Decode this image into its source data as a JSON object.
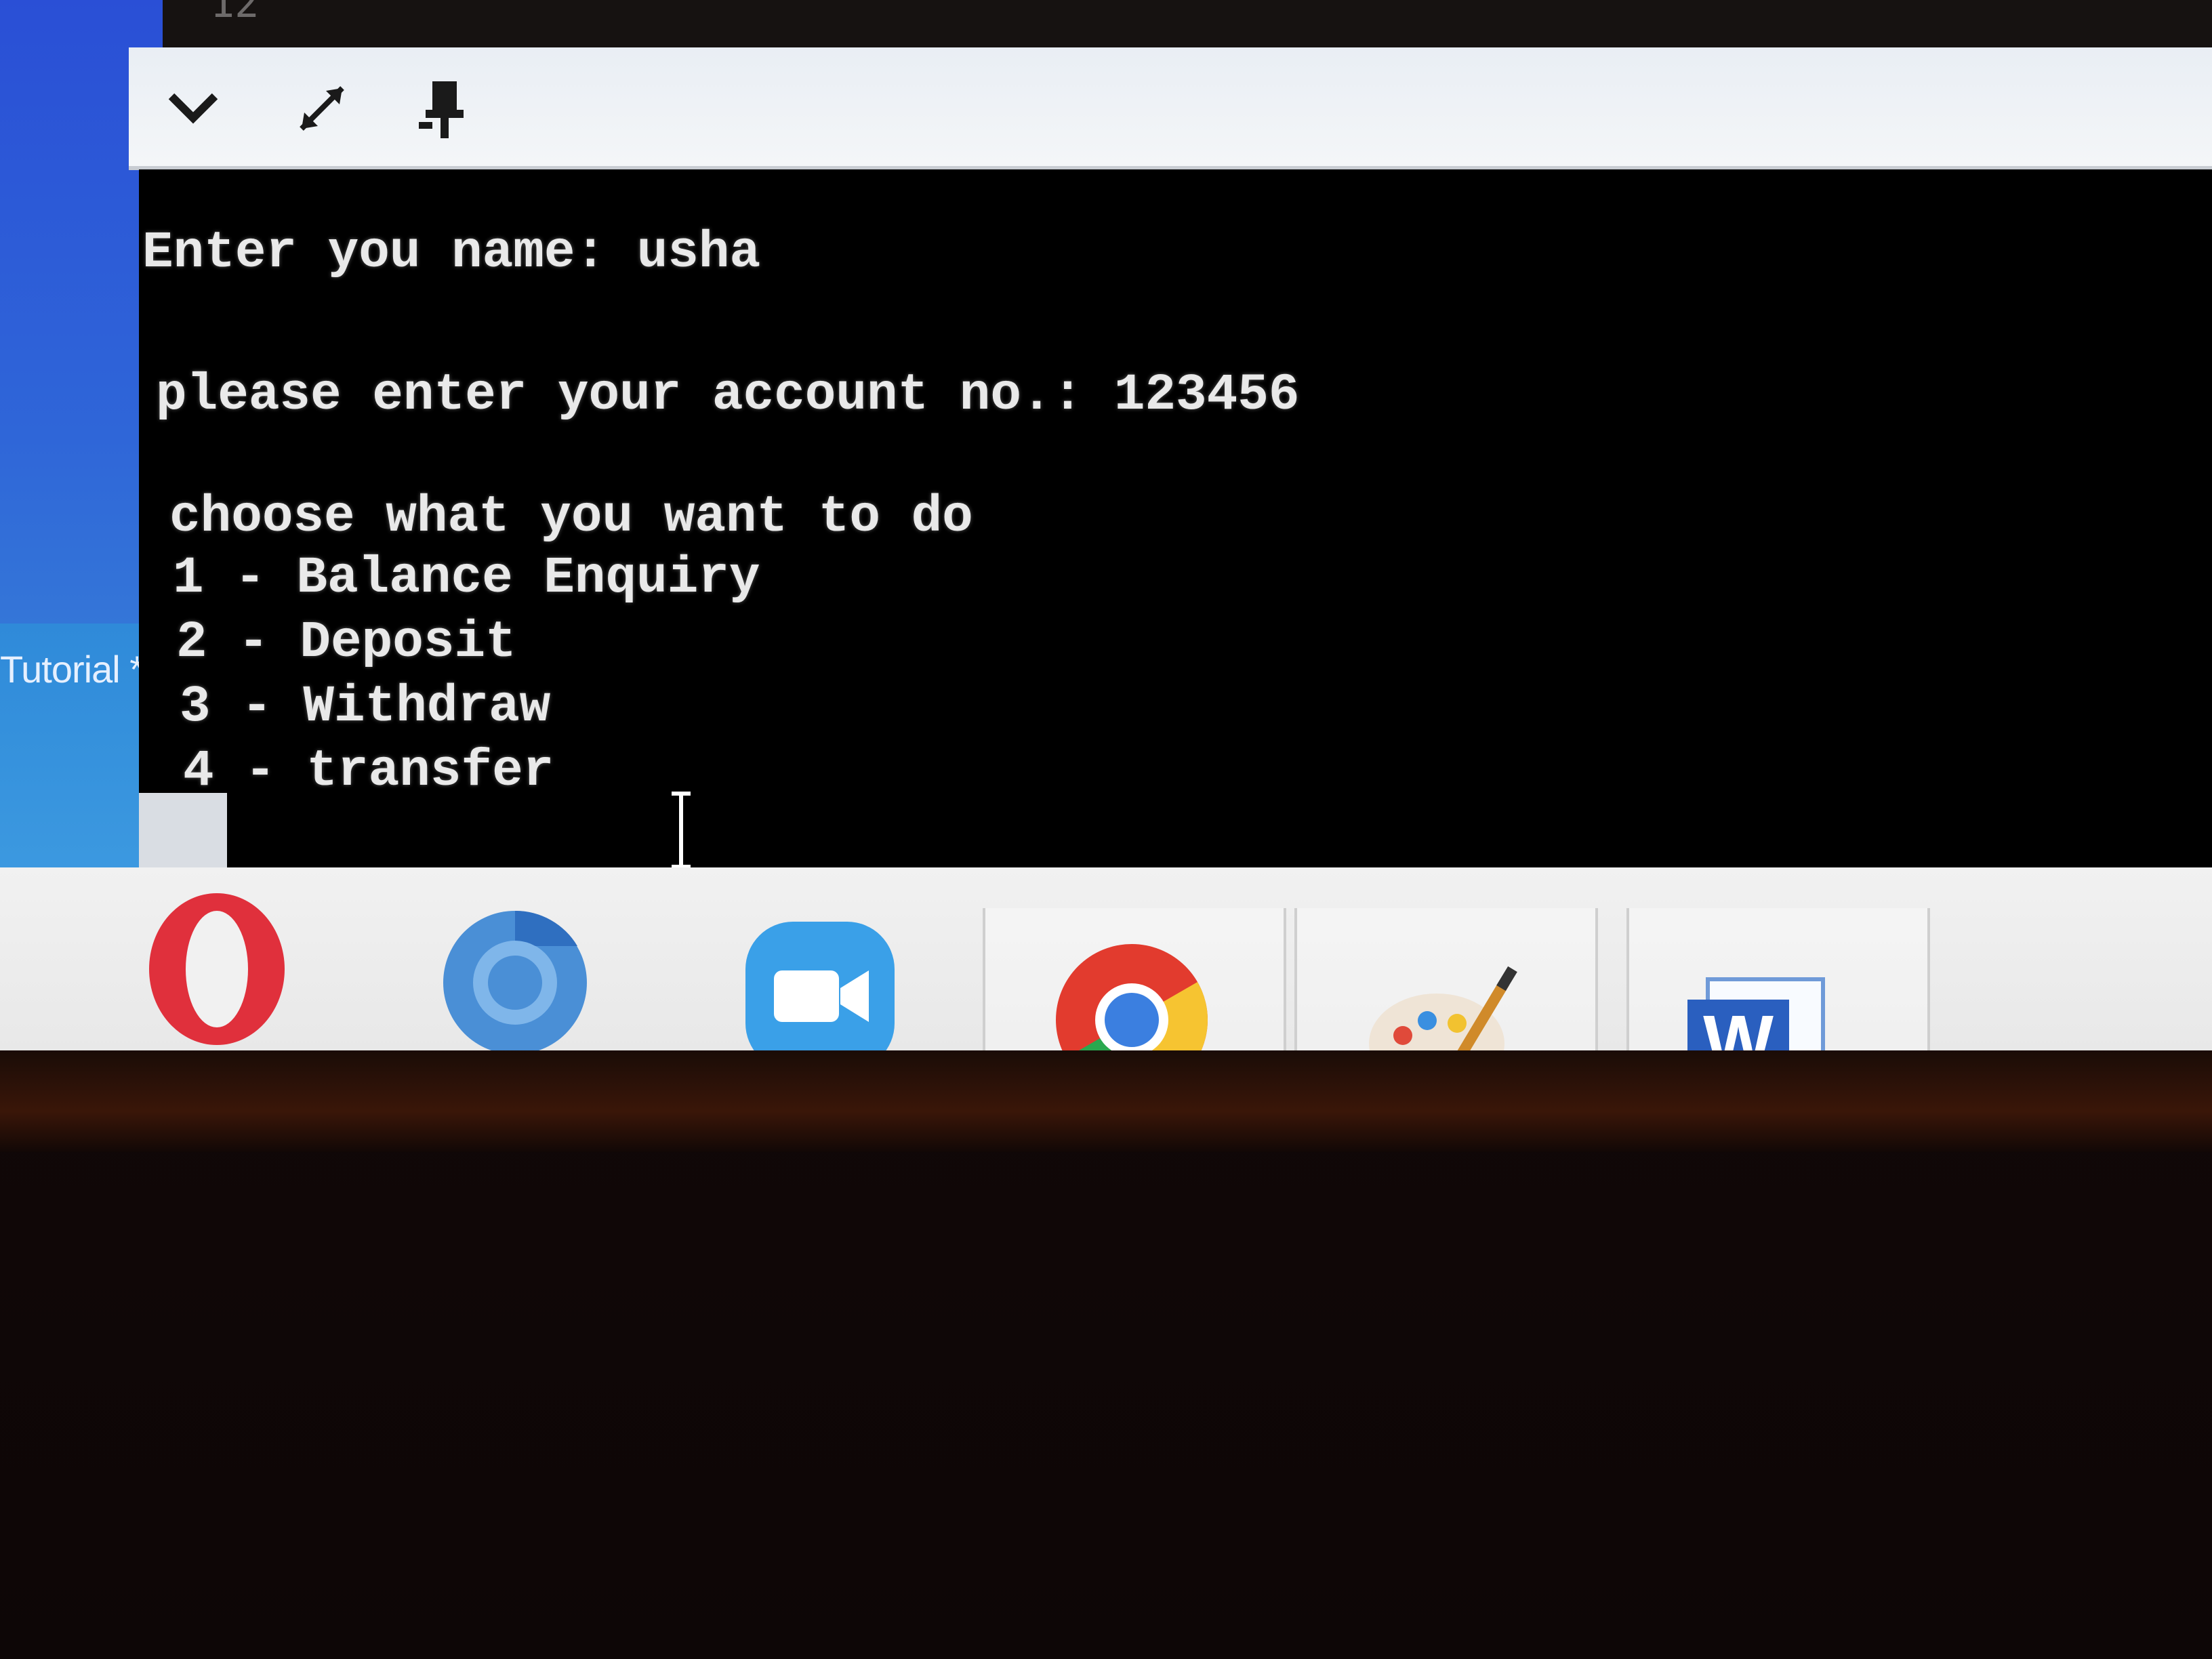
{
  "background": {
    "top_label": "12"
  },
  "side_panel": {
    "tab_label": "Tutorial *"
  },
  "toolbar": {
    "icons": [
      "chevron-down-icon",
      "expand-icon",
      "pin-icon"
    ]
  },
  "console": {
    "lines": [
      "Enter you name: usha",
      "please enter your account no.: 123456",
      "choose what you want to do",
      "1 - Balance Enquiry",
      "2 - Deposit",
      "3 - Withdraw",
      "4 - transfer"
    ],
    "text_color": "#e9e9e9",
    "background_color": "#000000"
  },
  "taskbar": {
    "apps": [
      {
        "name": "opera-icon"
      },
      {
        "name": "chromium-icon"
      },
      {
        "name": "zoom-icon"
      },
      {
        "name": "chrome-icon"
      },
      {
        "name": "paint-icon"
      },
      {
        "name": "word-icon",
        "letter": "W"
      }
    ]
  },
  "colors": {
    "accent_blue": "#2f66d8",
    "opera_red": "#e0303c",
    "zoom_blue": "#3aa0e8",
    "word_blue": "#2a5fbf"
  }
}
